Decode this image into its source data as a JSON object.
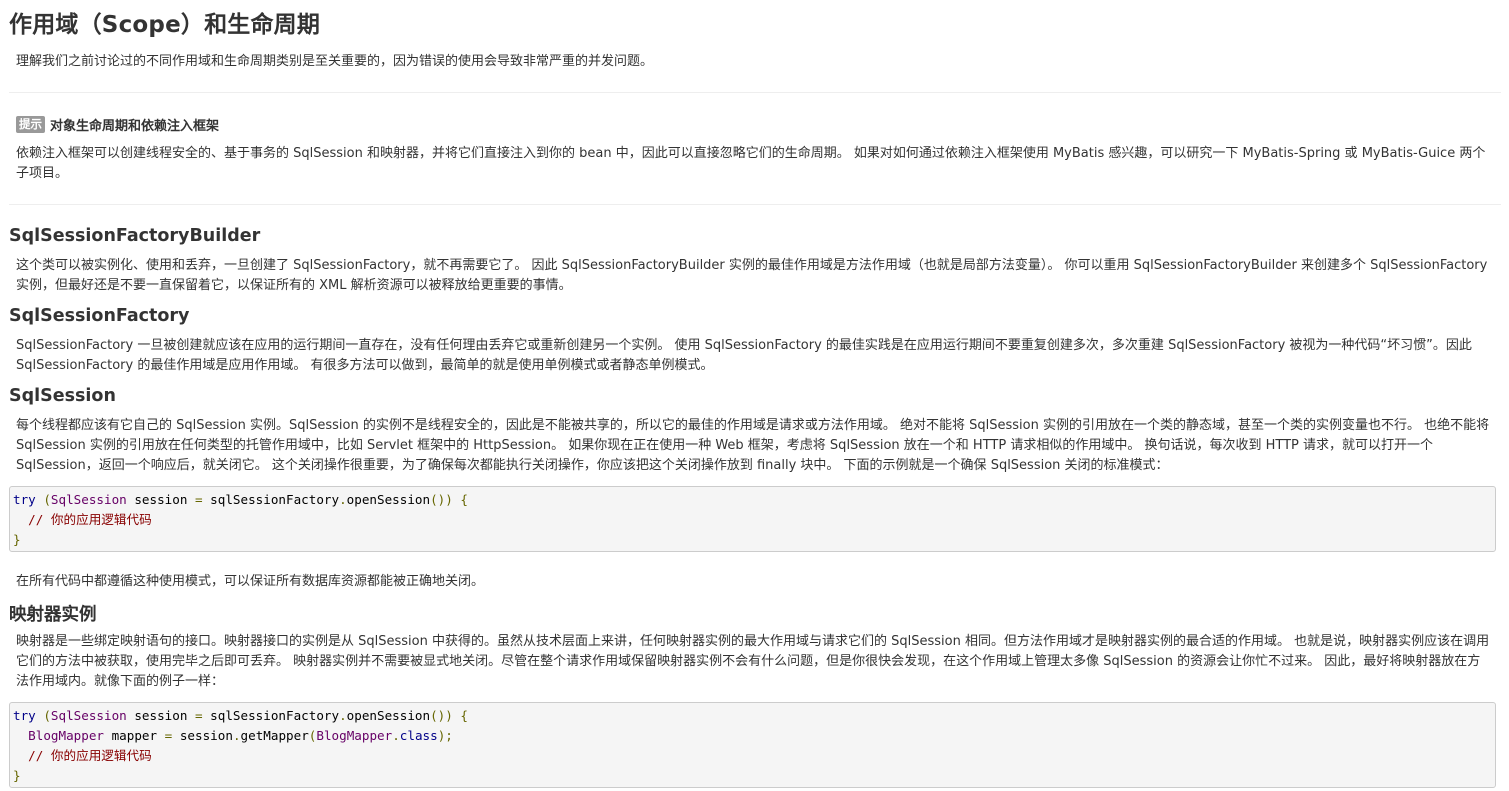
{
  "header": {
    "title": "作用域（Scope）和生命周期"
  },
  "intro": "理解我们之前讨论过的不同作用域和生命周期类别是至关重要的，因为错误的使用会导致非常严重的并发问题。",
  "callout": {
    "badge": "提示",
    "title": "对象生命周期和依赖注入框架",
    "text": "依赖注入框架可以创建线程安全的、基于事务的 SqlSession 和映射器，并将它们直接注入到你的 bean 中，因此可以直接忽略它们的生命周期。 如果对如何通过依赖注入框架使用 MyBatis 感兴趣，可以研究一下 MyBatis-Spring 或 MyBatis-Guice 两个子项目。"
  },
  "sections": [
    {
      "title": "SqlSessionFactoryBuilder",
      "text": "这个类可以被实例化、使用和丢弃，一旦创建了 SqlSessionFactory，就不再需要它了。 因此 SqlSessionFactoryBuilder 实例的最佳作用域是方法作用域（也就是局部方法变量）。 你可以重用 SqlSessionFactoryBuilder 来创建多个 SqlSessionFactory 实例，但最好还是不要一直保留着它，以保证所有的 XML 解析资源可以被释放给更重要的事情。"
    },
    {
      "title": "SqlSessionFactory",
      "text": "SqlSessionFactory 一旦被创建就应该在应用的运行期间一直存在，没有任何理由丢弃它或重新创建另一个实例。 使用 SqlSessionFactory 的最佳实践是在应用运行期间不要重复创建多次，多次重建 SqlSessionFactory 被视为一种代码“坏习惯”。因此 SqlSessionFactory 的最佳作用域是应用作用域。 有很多方法可以做到，最简单的就是使用单例模式或者静态单例模式。"
    },
    {
      "title": "SqlSession",
      "text": "每个线程都应该有它自己的 SqlSession 实例。SqlSession 的实例不是线程安全的，因此是不能被共享的，所以它的最佳的作用域是请求或方法作用域。 绝对不能将 SqlSession 实例的引用放在一个类的静态域，甚至一个类的实例变量也不行。 也绝不能将 SqlSession 实例的引用放在任何类型的托管作用域中，比如 Servlet 框架中的 HttpSession。 如果你现在正在使用一种 Web 框架，考虑将 SqlSession 放在一个和 HTTP 请求相似的作用域中。 换句话说，每次收到 HTTP 请求，就可以打开一个 SqlSession，返回一个响应后，就关闭它。 这个关闭操作很重要，为了确保每次都能执行关闭操作，你应该把这个关闭操作放到 finally 块中。 下面的示例就是一个确保 SqlSession 关闭的标准模式：",
      "code": {
        "kw_try": "try",
        "open_paren": " (",
        "type_sqlsession": "SqlSession",
        "decl": " session ",
        "eq": "=",
        "call": " sqlSessionFactory",
        "dot_open": ".",
        "method": "openSession",
        "close_brace": "()) {",
        "comment": "// 你的应用逻辑代码",
        "end_brace": "}"
      },
      "after_text": "在所有代码中都遵循这种使用模式，可以保证所有数据库资源都能被正确地关闭。"
    },
    {
      "title": "映射器实例",
      "text": "映射器是一些绑定映射语句的接口。映射器接口的实例是从 SqlSession 中获得的。虽然从技术层面上来讲，任何映射器实例的最大作用域与请求它们的 SqlSession 相同。但方法作用域才是映射器实例的最合适的作用域。 也就是说，映射器实例应该在调用它们的方法中被获取，使用完毕之后即可丢弃。 映射器实例并不需要被显式地关闭。尽管在整个请求作用域保留映射器实例不会有什么问题，但是你很快会发现，在这个作用域上管理太多像 SqlSession 的资源会让你忙不过来。 因此，最好将映射器放在方法作用域内。就像下面的例子一样：",
      "code": {
        "kw_try": "try",
        "open_paren": " (",
        "type_sqlsession": "SqlSession",
        "decl": " session ",
        "eq": "=",
        "call": " sqlSessionFactory",
        "dot_open": ".",
        "method": "openSession",
        "close_brace": "()) {",
        "type_mapper": "BlogMapper",
        "mapper_var": " mapper ",
        "mapper_call": " session",
        "get_mapper": "getMapper",
        "paren_open": "(",
        "type_mapper2": "BlogMapper",
        "class_kw": "class",
        "paren_close": ");",
        "comment": "// 你的应用逻辑代码",
        "end_brace": "}"
      }
    }
  ]
}
